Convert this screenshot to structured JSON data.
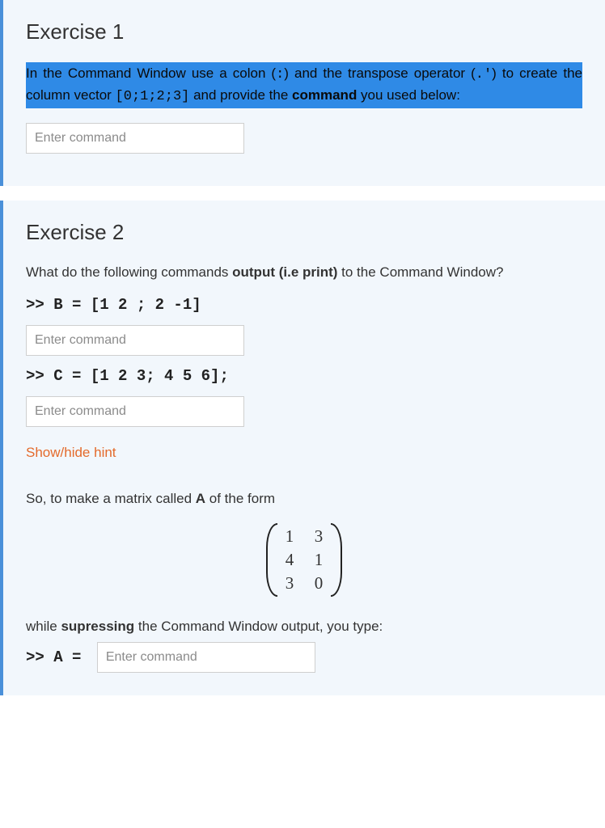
{
  "exercise1": {
    "title": "Exercise 1",
    "highlighted": {
      "p1a": "In the Command Window use a colon (",
      "p1b": ":",
      "p1c": ") and the transpose operator (",
      "p1d": ".'",
      "p1e": ") to create the column vector ",
      "p1f": "[0;1;2;3]",
      "p1g": " and provide the ",
      "p1h": "command",
      "p1i": " you used below:"
    },
    "input_placeholder": "Enter command"
  },
  "exercise2": {
    "title": "Exercise 2",
    "question_a": "What do the following commands ",
    "question_b": "output (i.e print)",
    "question_c": " to the Command Window?",
    "code_b": ">> B = [1 2 ; 2 -1]",
    "input_b_placeholder": "Enter command",
    "code_c": ">> C = [1 2 3; 4 5 6];",
    "input_c_placeholder": "Enter command",
    "hint_label": "Show/hide hint",
    "so_a": "So, to make a matrix called ",
    "so_b": "A",
    "so_c": " of the form",
    "matrix": {
      "r0c0": "1",
      "r0c1": "3",
      "r1c0": "4",
      "r1c1": "1",
      "r2c0": "3",
      "r2c1": "0"
    },
    "while_a": "while ",
    "while_b": "supressing",
    "while_c": " the Command Window output, you type:",
    "code_a_prompt": ">> A = ",
    "input_a_placeholder": "Enter command"
  }
}
